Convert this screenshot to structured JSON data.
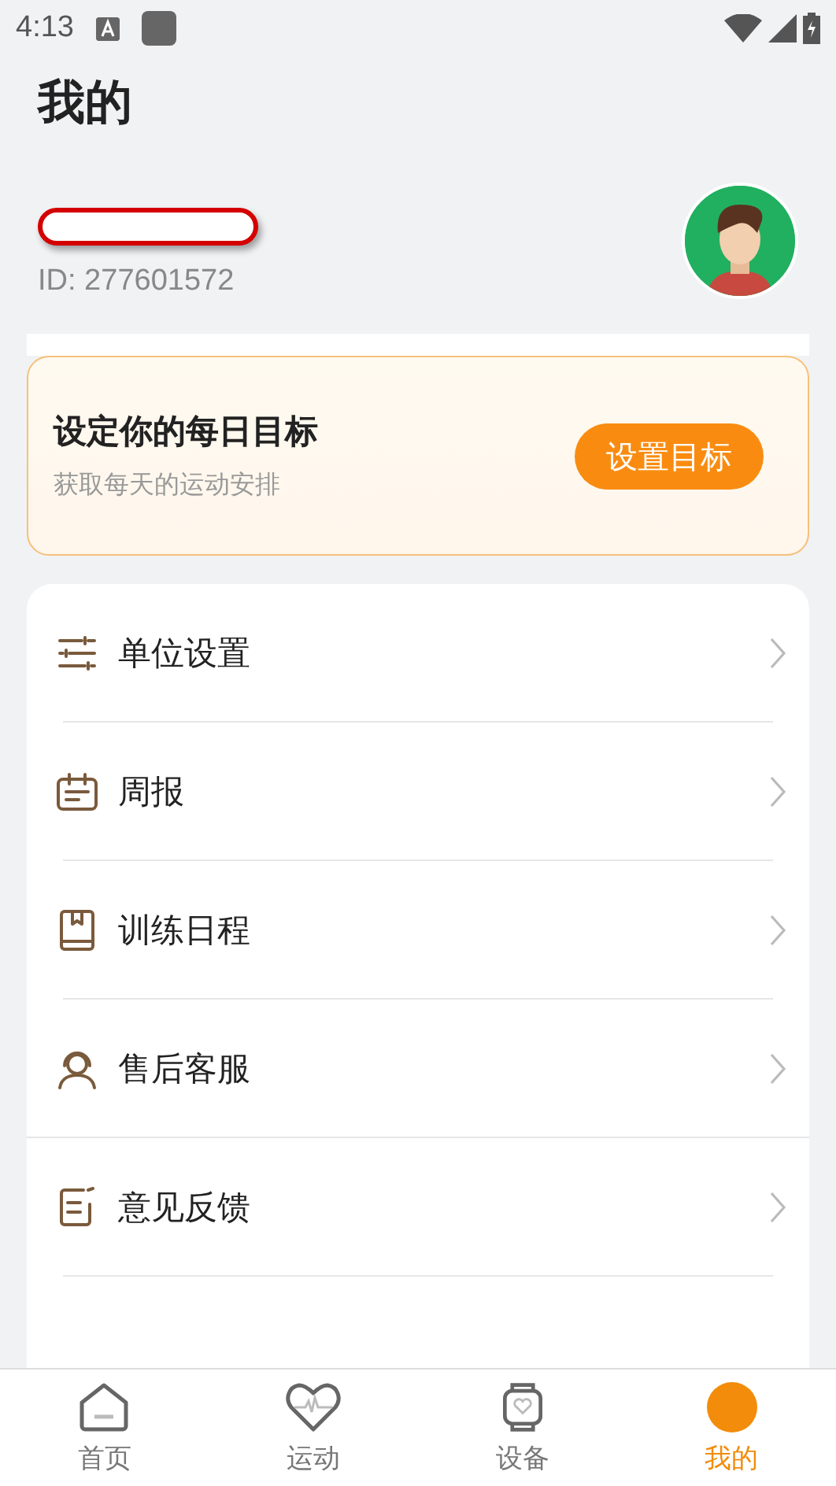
{
  "status_bar": {
    "time": "4:13"
  },
  "title": "我的",
  "profile": {
    "id_text": "ID: 277601572"
  },
  "goal_card": {
    "title": "设定你的每日目标",
    "subtitle": "获取每天的运动安排",
    "button": "设置目标"
  },
  "menu": [
    {
      "kind": "sliders",
      "label": "单位设置",
      "section_end": false
    },
    {
      "kind": "calendar",
      "label": "周报",
      "section_end": false
    },
    {
      "kind": "book",
      "label": "训练日程",
      "section_end": false
    },
    {
      "kind": "headset",
      "label": "售后客服",
      "section_end": true
    },
    {
      "kind": "note",
      "label": "意见反馈",
      "section_end": false
    }
  ],
  "tab_bar": [
    {
      "kind": "home",
      "label": "首页",
      "selected": false
    },
    {
      "kind": "heart",
      "label": "运动",
      "selected": false
    },
    {
      "kind": "watch",
      "label": "设备",
      "selected": false
    },
    {
      "kind": "me",
      "label": "我的",
      "selected": true
    }
  ]
}
